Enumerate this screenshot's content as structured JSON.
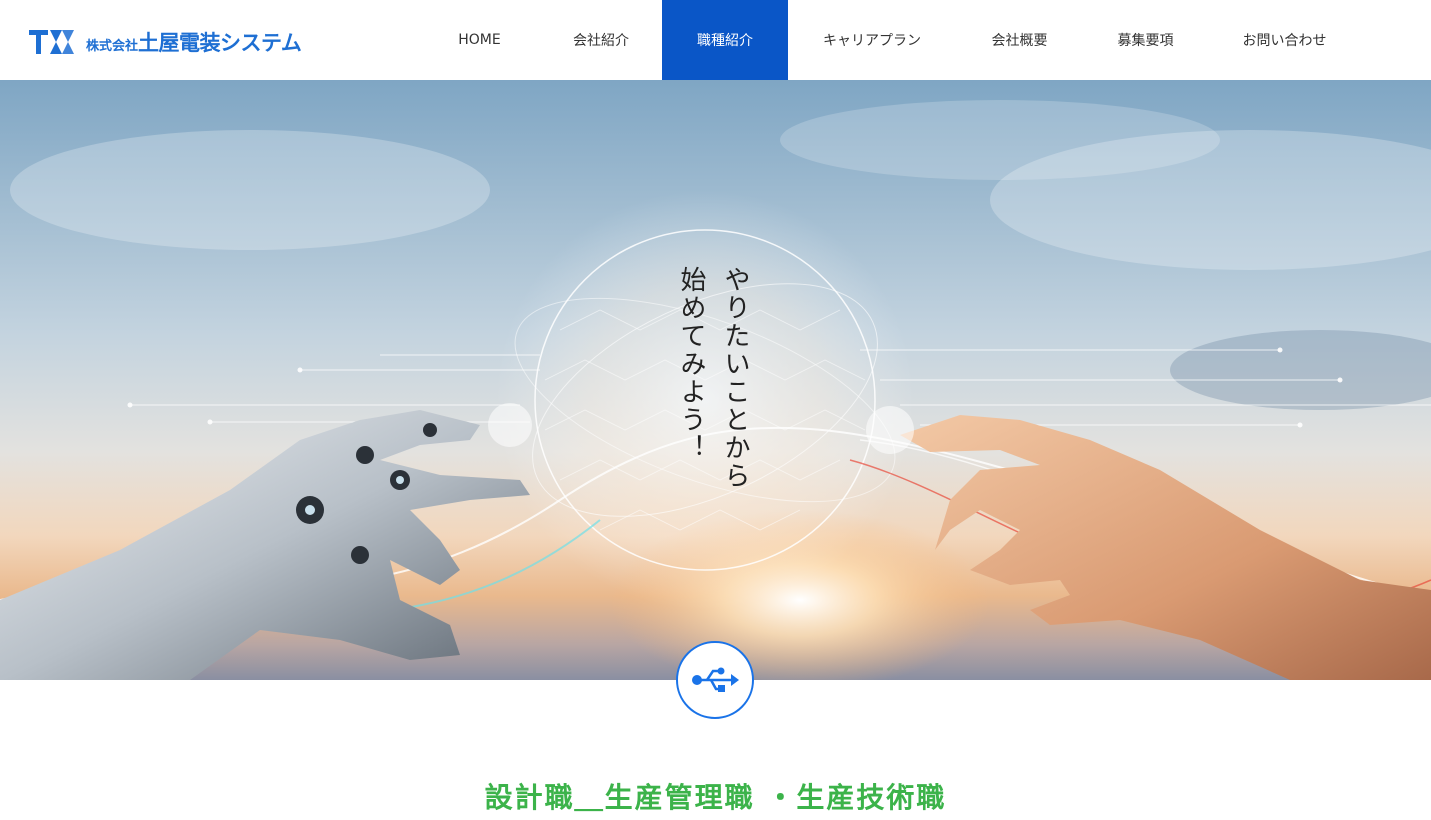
{
  "header": {
    "logo": {
      "mark": "TS",
      "prefix": "株式会社",
      "name": "土屋電装システム"
    },
    "nav": [
      {
        "label": "HOME",
        "active": false
      },
      {
        "label": "会社紹介",
        "active": false
      },
      {
        "label": "職種紹介",
        "active": true
      },
      {
        "label": "キャリアプラン",
        "active": false
      },
      {
        "label": "会社概要",
        "active": false
      },
      {
        "label": "募集要項",
        "active": false
      },
      {
        "label": "お問い合わせ",
        "active": false
      }
    ]
  },
  "hero": {
    "line1": "やりたいことから",
    "line2": "始めてみよう！"
  },
  "badge": {
    "icon": "usb-icon"
  },
  "section": {
    "title": "設計職＿生産管理職 ・生産技術職"
  },
  "colors": {
    "brand": "#1e6fd3",
    "nav_active": "#0a56c7",
    "title_green": "#3cb34a"
  }
}
